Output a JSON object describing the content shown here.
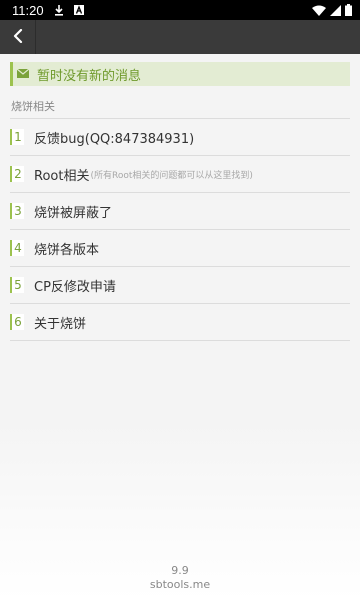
{
  "status_bar": {
    "time": "11:20",
    "icons": [
      "download-icon",
      "a-notification-icon",
      "wifi-icon",
      "signal-icon",
      "battery-icon"
    ]
  },
  "app_bar": {
    "back_icon": "chevron-left-icon"
  },
  "notice": {
    "icon": "mail-icon",
    "text": "暂时没有新的消息"
  },
  "section": {
    "title": "烧饼相关"
  },
  "menu": {
    "items": [
      {
        "num": "1",
        "label": "反馈bug(QQ:847384931)",
        "sub": ""
      },
      {
        "num": "2",
        "label": "Root相关",
        "sub": "(所有Root相关的问题都可以从这里找到)"
      },
      {
        "num": "3",
        "label": "烧饼被屏蔽了",
        "sub": ""
      },
      {
        "num": "4",
        "label": "烧饼各版本",
        "sub": ""
      },
      {
        "num": "5",
        "label": "CP反修改申请",
        "sub": ""
      },
      {
        "num": "6",
        "label": "关于烧饼",
        "sub": ""
      }
    ]
  },
  "footer": {
    "version": "9.9",
    "site": "sbtools.me"
  },
  "colors": {
    "accent": "#9cc24e",
    "accent_text": "#6f9a2c",
    "app_bar": "#3a3a3a",
    "status_bar": "#000000"
  }
}
